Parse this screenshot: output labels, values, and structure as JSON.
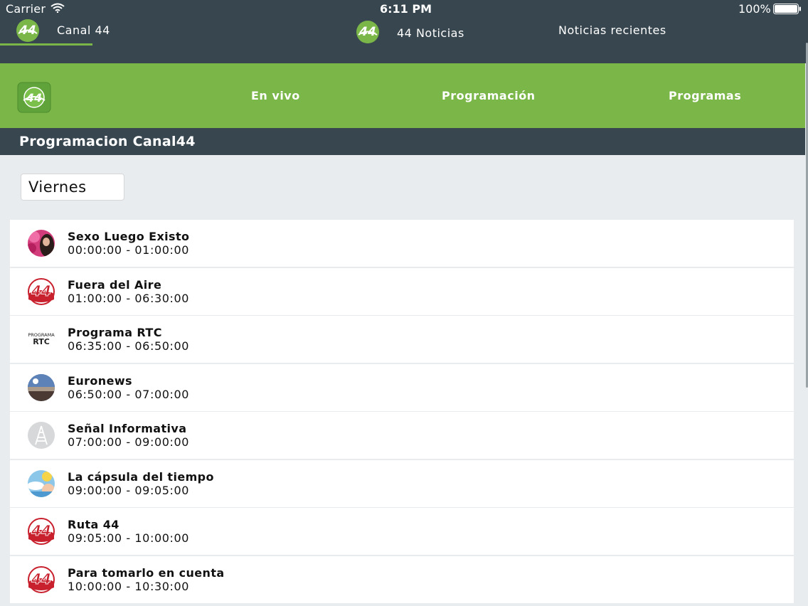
{
  "status_bar": {
    "carrier": "Carrier",
    "time": "6:11 PM",
    "battery": "100%"
  },
  "top_tabs": [
    {
      "label": "Canal 44",
      "logo_text": "44",
      "active": true
    },
    {
      "label": "44 Noticias",
      "logo_text": "44",
      "active": false
    },
    {
      "label": "Noticias recientes",
      "active": false
    }
  ],
  "nav": {
    "logo_text": "44",
    "items": [
      "En vivo",
      "Programación",
      "Programas"
    ]
  },
  "section_title": "Programacion Canal44",
  "day_selector": {
    "value": "Viernes"
  },
  "schedule": [
    {
      "title": "Sexo Luego Existo",
      "time": "00:00:00 - 01:00:00",
      "thumb": "photo-pink"
    },
    {
      "title": "Fuera del Aire",
      "time": "01:00:00 - 06:30:00",
      "thumb": "logo-44"
    },
    {
      "title": "Programa RTC",
      "time": "06:35:00 - 06:50:00",
      "thumb": "rtc-text",
      "thumb_text": [
        "PROGRAMA",
        "RTC"
      ]
    },
    {
      "title": "Euronews",
      "time": "06:50:00 - 07:00:00",
      "thumb": "photo-sky"
    },
    {
      "title": "Señal Informativa",
      "time": "07:00:00 - 09:00:00",
      "thumb": "tower-icon"
    },
    {
      "title": "La cápsula del tiempo",
      "time": "09:00:00 - 09:05:00",
      "thumb": "photo-weather"
    },
    {
      "title": "Ruta 44",
      "time": "09:05:00 - 10:00:00",
      "thumb": "logo-44"
    },
    {
      "title": "Para tomarlo en cuenta",
      "time": "10:00:00 - 10:30:00",
      "thumb": "logo-44"
    }
  ],
  "colors": {
    "dark_bar": "#37464f",
    "accent_green": "#7ab648",
    "logo_red": "#c8202d"
  }
}
